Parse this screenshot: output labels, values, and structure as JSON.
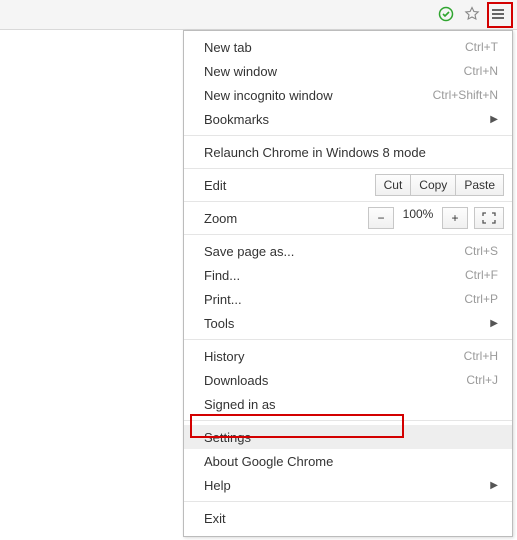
{
  "toolbar": {
    "check_icon": "check-circle-icon",
    "star_icon": "star-icon",
    "menu_icon": "menu-icon"
  },
  "menu": {
    "new_tab": {
      "label": "New tab",
      "shortcut": "Ctrl+T"
    },
    "new_window": {
      "label": "New window",
      "shortcut": "Ctrl+N"
    },
    "new_incognito": {
      "label": "New incognito window",
      "shortcut": "Ctrl+Shift+N"
    },
    "bookmarks": {
      "label": "Bookmarks"
    },
    "relaunch": {
      "label": "Relaunch Chrome in Windows 8 mode"
    },
    "edit": {
      "label": "Edit",
      "cut": "Cut",
      "copy": "Copy",
      "paste": "Paste"
    },
    "zoom": {
      "label": "Zoom",
      "minus": "−",
      "value": "100%",
      "plus": "+"
    },
    "save_page": {
      "label": "Save page as...",
      "shortcut": "Ctrl+S"
    },
    "find": {
      "label": "Find...",
      "shortcut": "Ctrl+F"
    },
    "print": {
      "label": "Print...",
      "shortcut": "Ctrl+P"
    },
    "tools": {
      "label": "Tools"
    },
    "history": {
      "label": "History",
      "shortcut": "Ctrl+H"
    },
    "downloads": {
      "label": "Downloads",
      "shortcut": "Ctrl+J"
    },
    "signed_in": {
      "label": "Signed in as"
    },
    "settings": {
      "label": "Settings"
    },
    "about": {
      "label": "About Google Chrome"
    },
    "help": {
      "label": "Help"
    },
    "exit": {
      "label": "Exit"
    }
  }
}
